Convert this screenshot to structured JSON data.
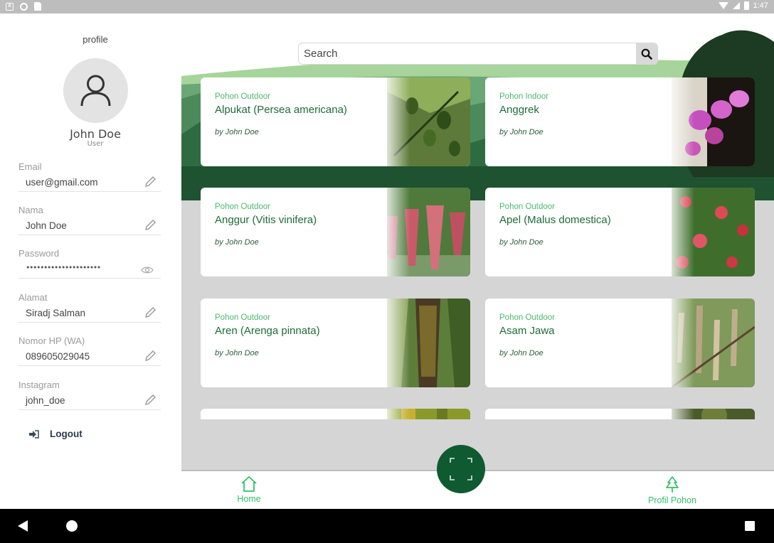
{
  "status_bar": {
    "time": "1:47",
    "icons": [
      "a-icon",
      "circle-icon",
      "sd-card-icon",
      "wifi-icon",
      "signal-icon",
      "battery-icon"
    ]
  },
  "sidebar": {
    "title": "profile",
    "user_name": "John Doe",
    "user_role": "User",
    "fields": [
      {
        "label": "Email",
        "value": "user@gmail.com",
        "icon": "edit-icon"
      },
      {
        "label": "Nama",
        "value": "John Doe",
        "icon": "edit-icon"
      },
      {
        "label": "Password",
        "value": "•••••••••••••••••••••",
        "icon": "eye-icon"
      },
      {
        "label": "Alamat",
        "value": "Siradj Salman",
        "icon": "edit-icon"
      },
      {
        "label": "Nomor HP (WA)",
        "value": "089605029045",
        "icon": "edit-icon"
      },
      {
        "label": "Instagram",
        "value": "john_doe",
        "icon": "edit-icon"
      }
    ],
    "logout_label": "Logout"
  },
  "search": {
    "placeholder": "Search"
  },
  "cards": [
    {
      "category": "Pohon Outdoor",
      "title": "Alpukat (Persea americana)",
      "author": "by John Doe",
      "image": "avocado-tree"
    },
    {
      "category": "Pohon Indoor",
      "title": "Anggrek",
      "author": "by John Doe",
      "image": "orchid"
    },
    {
      "category": "Pohon Outdoor",
      "title": "Anggur (Vitis vinifera)",
      "author": "by John Doe",
      "image": "grapes"
    },
    {
      "category": "Pohon Outdoor",
      "title": "Apel (Malus domestica)",
      "author": "by John Doe",
      "image": "apple-tree"
    },
    {
      "category": "Pohon Outdoor",
      "title": "Aren (Arenga pinnata)",
      "author": "by John Doe",
      "image": "sugar-palm"
    },
    {
      "category": "Pohon Outdoor",
      "title": "Asam Jawa",
      "author": "by John Doe",
      "image": "tamarind"
    }
  ],
  "bottom_nav": {
    "home": "Home",
    "tree_profile": "Profil Pohon"
  },
  "colors": {
    "brand_dark": "#0f5a30",
    "brand_light": "#34c06a",
    "accent_text": "#1f6b3a"
  }
}
